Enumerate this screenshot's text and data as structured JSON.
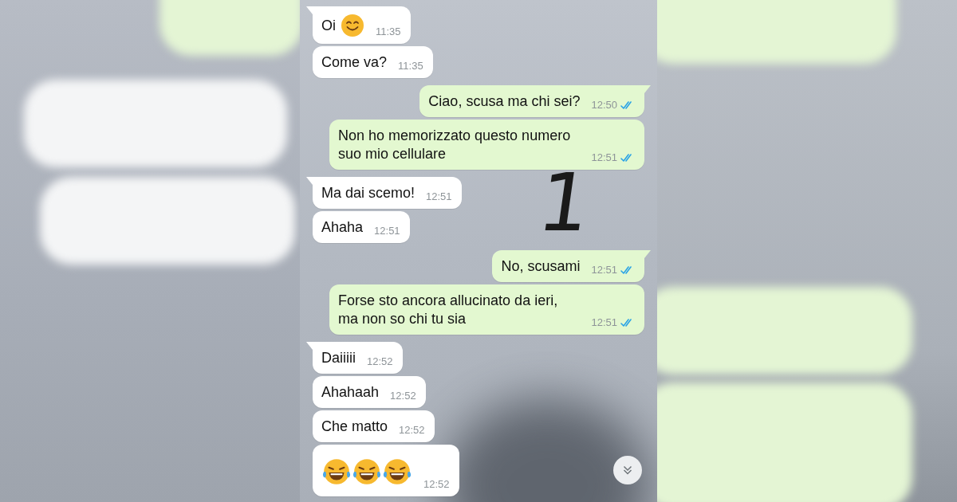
{
  "chat": {
    "wallpaper_mark": "1",
    "messages": [
      {
        "kind": "text_with_smile",
        "text": "Oi",
        "time": "11:35",
        "outgoing": false,
        "tail": true
      },
      {
        "kind": "text",
        "text": "Come va?",
        "time": "11:35",
        "outgoing": false,
        "tail": false
      },
      {
        "kind": "text",
        "text": "Ciao, scusa ma chi sei?",
        "time": "12:50",
        "outgoing": true,
        "tail": true,
        "read": true
      },
      {
        "kind": "text",
        "text": "Non ho memorizzato questo numero suo mio cellulare",
        "time": "12:51",
        "outgoing": true,
        "tail": false,
        "read": true
      },
      {
        "kind": "text",
        "text": "Ma dai scemo!",
        "time": "12:51",
        "outgoing": false,
        "tail": true
      },
      {
        "kind": "text",
        "text": "Ahaha",
        "time": "12:51",
        "outgoing": false,
        "tail": false
      },
      {
        "kind": "text",
        "text": "No, scusami",
        "time": "12:51",
        "outgoing": true,
        "tail": true,
        "read": true
      },
      {
        "kind": "text",
        "text": "Forse sto ancora allucinato da ieri, ma non so chi tu sia",
        "time": "12:51",
        "outgoing": true,
        "tail": false,
        "read": true
      },
      {
        "kind": "text",
        "text": "Daiiiii",
        "time": "12:52",
        "outgoing": false,
        "tail": true
      },
      {
        "kind": "text",
        "text": "Ahahaah",
        "time": "12:52",
        "outgoing": false,
        "tail": false
      },
      {
        "kind": "text",
        "text": "Che matto",
        "time": "12:52",
        "outgoing": false,
        "tail": false
      },
      {
        "kind": "laugh_row",
        "time": "12:52",
        "outgoing": false,
        "tail": false
      }
    ]
  }
}
